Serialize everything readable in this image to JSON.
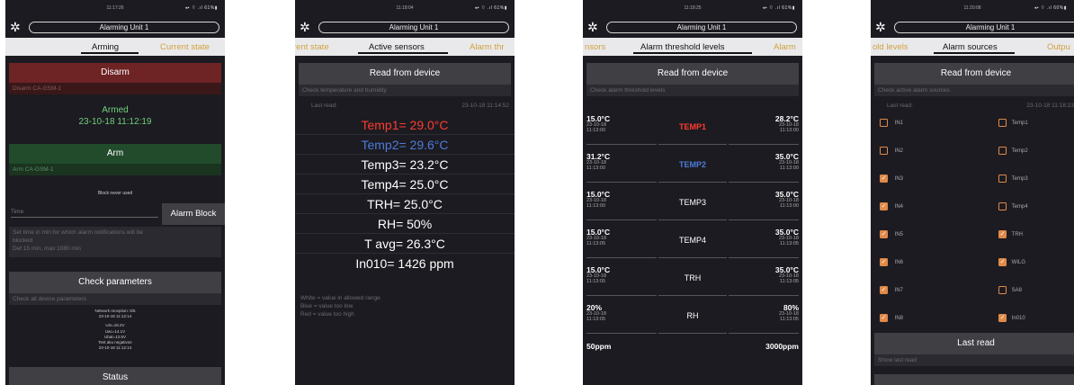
{
  "status_times": [
    "11:17:26",
    "11:18:04",
    "11:18:25",
    "11:20:08"
  ],
  "status_icons": [
    "◂▪ ⌔ .ıl 61%▮",
    "◂▪ ⌔ .ıl 61%▮",
    "◂▪ ⌔ .ıl 61%▮",
    "◂▪ ⌔ .ıl 60%▮"
  ],
  "unit_name": "Alarming Unit 1",
  "screen1": {
    "tab_active": "Arming",
    "tab_next": "Current state",
    "disarm_label": "Disarm",
    "disarm_hint": "Disarm CA-GSM-1",
    "armed_status": "Armed",
    "armed_time": "23-10-18 11:12:19",
    "arm_label": "Arm",
    "arm_hint": "Arm CA-GSM-1",
    "block_never": "Block never used",
    "time_placeholder": "Time",
    "alarm_block_label": "Alarm Block",
    "block_hint1": "Set time in min for which alarm notifications will be",
    "block_hint2": "blocked",
    "block_hint3": "Def 15 min, max 1080 min",
    "check_label": "Check parameters",
    "check_hint": "Check all device parameters",
    "params": [
      "Network reception: 5/5",
      "23-10-18 11:12:14",
      "Uin=18.2V",
      "Uac=14.1V",
      "Ubat=13.8V",
      "Test aku negativne",
      "23-10-18 11:12:14"
    ],
    "status_label": "Status"
  },
  "screen2": {
    "tab_prev": "rent state",
    "tab_active": "Active sensors",
    "tab_next": "Alarm thr",
    "read_label": "Read from device",
    "read_hint": "Check temperature and humidity",
    "last_read_label": "Last read:",
    "last_read_time": "23-10-18 11:14:52",
    "readings": [
      "Temp1= 29.0°C",
      "Temp2= 29.6°C",
      "Temp3= 23.2°C",
      "Temp4= 25.0°C",
      "TRH= 25.0°C",
      "RH= 50%",
      "T avg= 26.3°C",
      "In010= 1426 ppm"
    ],
    "reading_colors": [
      "#ff3b30",
      "#4d7bd9",
      "#ffffff",
      "#ffffff",
      "#ffffff",
      "#ffffff",
      "#ffffff",
      "#ffffff"
    ],
    "legend": [
      "White = value in allowed range",
      "Blue = value too low",
      "Red = value too high"
    ]
  },
  "screen3": {
    "tab_prev": "nsors",
    "tab_active": "Alarm threshold levels",
    "tab_next": "Alarm",
    "read_label": "Read from device",
    "read_hint": "Check alarm threshold levels",
    "rows": [
      {
        "name": "TEMP1",
        "color": "#ff3b30",
        "low": "15.0°C",
        "low_date": "23-10-18",
        "low_time": "11:13:00",
        "high": "28.2°C",
        "high_date": "23-10-18",
        "high_time": "11:13:00"
      },
      {
        "name": "TEMP2",
        "color": "#4d7bd9",
        "low": "31.2°C",
        "low_date": "23-10-18",
        "low_time": "11:13:00",
        "high": "35.0°C",
        "high_date": "23-10-18",
        "high_time": "11:13:00"
      },
      {
        "name": "TEMP3",
        "color": "#ffffff",
        "low": "15.0°C",
        "low_date": "23-10-18",
        "low_time": "11:13:00",
        "high": "35.0°C",
        "high_date": "23-10-18",
        "high_time": "11:13:00"
      },
      {
        "name": "TEMP4",
        "color": "#ffffff",
        "low": "15.0°C",
        "low_date": "23-10-18",
        "low_time": "11:13:05",
        "high": "35.0°C",
        "high_date": "23-10-18",
        "high_time": "11:13:05"
      },
      {
        "name": "TRH",
        "color": "#ffffff",
        "low": "15.0°C",
        "low_date": "23-10-18",
        "low_time": "11:13:05",
        "high": "35.0°C",
        "high_date": "23-10-18",
        "high_time": "11:13:05"
      },
      {
        "name": "RH",
        "color": "#ffffff",
        "low": "20%",
        "low_date": "23-10-18",
        "low_time": "11:13:05",
        "high": "80%",
        "high_date": "23-10-18",
        "high_time": "11:13:05"
      }
    ],
    "last_low": "50ppm",
    "last_high": "3000ppm"
  },
  "screen4": {
    "tab_prev": "old levels",
    "tab_active": "Alarm sources",
    "tab_next": "Outpu",
    "read_label": "Read from device",
    "read_hint": "Check active alarm sources",
    "last_read_label": "Last read:",
    "last_read_time": "23-10-18 11:18:23",
    "sources_left": [
      {
        "label": "IN1",
        "checked": false
      },
      {
        "label": "IN2",
        "checked": false
      },
      {
        "label": "IN3",
        "checked": true
      },
      {
        "label": "IN4",
        "checked": true
      },
      {
        "label": "IN5",
        "checked": true
      },
      {
        "label": "IN6",
        "checked": true
      },
      {
        "label": "IN7",
        "checked": true
      },
      {
        "label": "IN8",
        "checked": true
      }
    ],
    "sources_right": [
      {
        "label": "Temp1",
        "checked": false
      },
      {
        "label": "Temp2",
        "checked": false
      },
      {
        "label": "Temp3",
        "checked": false
      },
      {
        "label": "Temp4",
        "checked": false
      },
      {
        "label": "TRH",
        "checked": true
      },
      {
        "label": "WILG",
        "checked": true
      },
      {
        "label": "SA8",
        "checked": false
      },
      {
        "label": "In010",
        "checked": true
      }
    ],
    "last_read_btn": "Last read",
    "last_read_hint": "Show last read"
  },
  "colors": {
    "background": "#1c1b21",
    "tab_bar": "#e9e9ec",
    "tab_inactive": "#d1a23d",
    "disarm_button": "#6e2325",
    "disarm_hint_bg": "#3a1719",
    "arm_button": "#214b2b",
    "arm_hint_bg": "#1a3420",
    "armed_text": "#6fd07a",
    "grey_button": "#3f3f44",
    "checkbox": "#e08a49"
  },
  "icons": {
    "settings": "gear-icon",
    "checkbox_checked": "check-icon"
  }
}
